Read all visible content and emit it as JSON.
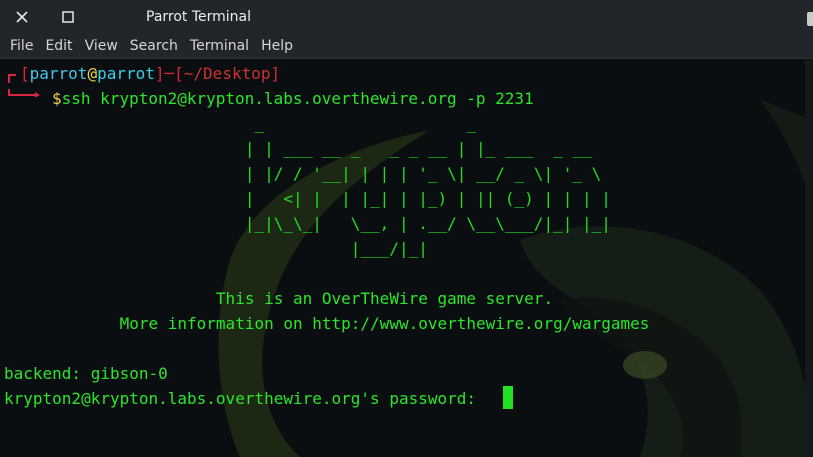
{
  "window": {
    "title": "Parrot Terminal"
  },
  "menu": [
    "File",
    "Edit",
    "View",
    "Search",
    "Terminal",
    "Help"
  ],
  "prompt": {
    "open_bracket": "[",
    "user": "parrot",
    "at": "@",
    "host": "parrot",
    "sep": "]─[",
    "path": "~/Desktop",
    "close_bracket": "]",
    "dollar": "$",
    "command": "ssh krypton2@krypton.labs.overthewire.org -p 2231"
  },
  "banner": [
    "                          _                     _",
    "                         | | ___ __ _   _ _ __ | |_ ___  _ __",
    "                         | |/ / '__| | | | '_ \\| __/ _ \\| '_ \\",
    "                         |   <| |  | |_| | |_) | || (_) | | | |",
    "                         |_|\\_\\_|   \\__, | .__/ \\__\\___/|_| |_|",
    "                                    |___/|_|"
  ],
  "motd": [
    "                      This is an OverTheWire game server.",
    "            More information on http://www.overthewire.org/wargames"
  ],
  "output": {
    "backend": "backend: gibson-0",
    "password_prompt": "krypton2@krypton.labs.overthewire.org's password: "
  },
  "colors": {
    "text_green": "#2ce52c",
    "prompt_red": "#d7263d",
    "background": "#0b0e10"
  }
}
